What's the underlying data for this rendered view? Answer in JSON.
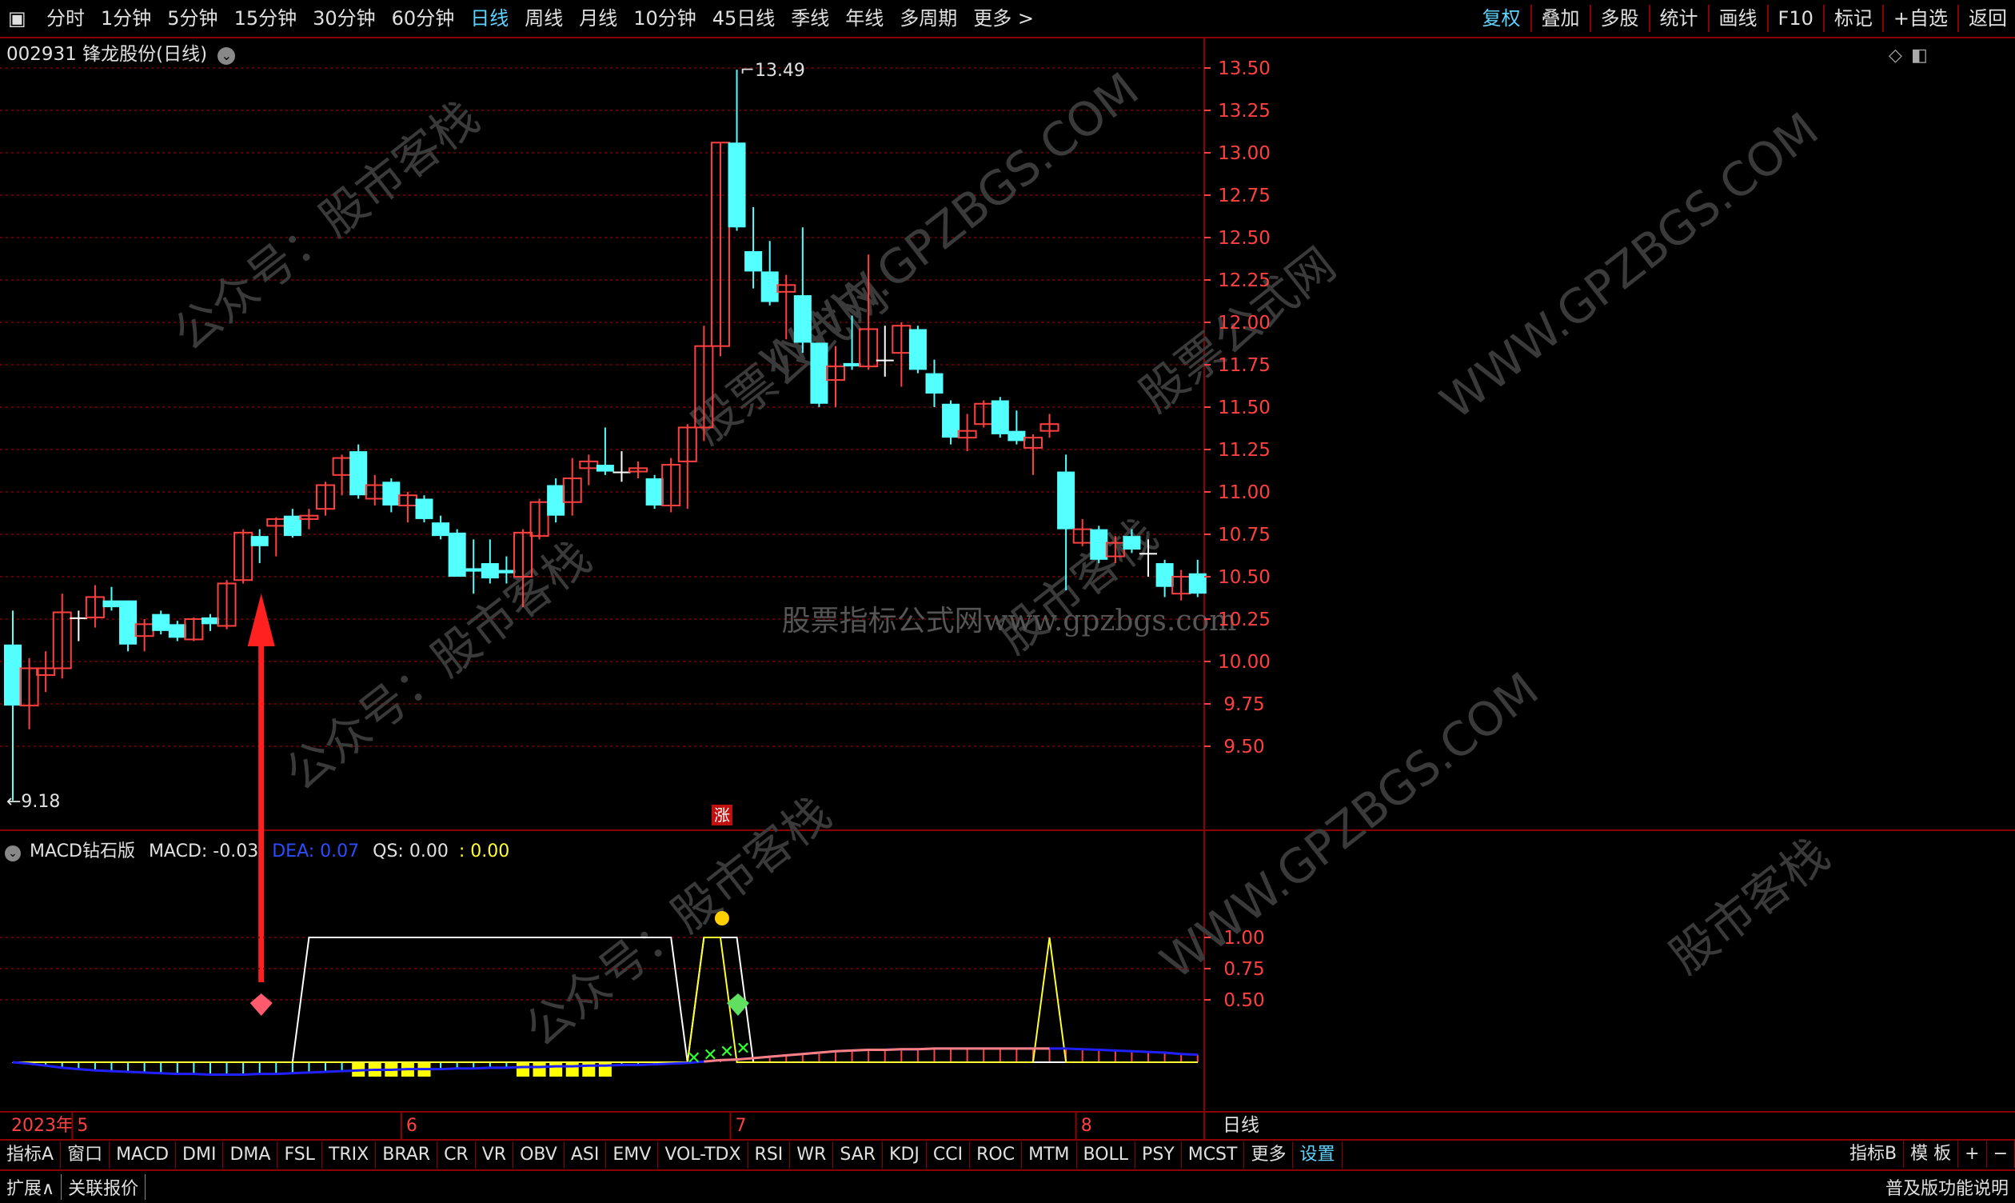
{
  "toolbar": {
    "periods": [
      "分时",
      "1分钟",
      "5分钟",
      "15分钟",
      "30分钟",
      "60分钟",
      "日线",
      "周线",
      "月线",
      "10分钟",
      "45日线",
      "季线",
      "年线",
      "多周期",
      "更多 >"
    ],
    "active_period": "日线",
    "right_tools": [
      "复权",
      "叠加",
      "多股",
      "统计",
      "画线",
      "F10",
      "标记",
      "+自选",
      "返回"
    ],
    "active_tool": "复权"
  },
  "stock": {
    "title": "002931 锋龙股份(日线)"
  },
  "price_axis": [
    "13.50",
    "13.25",
    "13.00",
    "12.75",
    "12.50",
    "12.25",
    "12.00",
    "11.75",
    "11.50",
    "11.25",
    "11.00",
    "10.75",
    "10.50",
    "10.25",
    "10.00",
    "9.75",
    "9.50"
  ],
  "annotations": {
    "high_label": "13.49",
    "low_label": "9.18",
    "zhang_badge": "涨",
    "watermark_center": "股票指标公式网www.gpzbgs.com",
    "watermarks": [
      "公众号：股市客栈",
      "WWW.GPZBGS.COM",
      "股票公式网",
      "股市客栈"
    ]
  },
  "indicator": {
    "name": "MACD钻石版",
    "macd_label": "MACD: -0.03",
    "dea_label": "DEA: 0.07",
    "qs_label": "QS: 0.00",
    "qs_value": ": 0.00",
    "axis": [
      "1.00",
      "0.75",
      "0.50"
    ]
  },
  "dates": {
    "year": "2023年",
    "months": [
      "5",
      "6",
      "7",
      "8"
    ],
    "period": "日线"
  },
  "colors": {
    "up": "#ff4040",
    "down": "#54ffff",
    "grid": "#7a0000",
    "dea": "#2020ff",
    "qs": "#ffff30"
  },
  "chart_data": {
    "type": "candlestick",
    "ylim": [
      9.1,
      13.6
    ],
    "candles": [
      {
        "o": 10.1,
        "c": 9.74,
        "h": 10.3,
        "l": 9.18
      },
      {
        "o": 9.74,
        "c": 9.96,
        "h": 10.02,
        "l": 9.6
      },
      {
        "o": 9.92,
        "c": 9.96,
        "h": 10.06,
        "l": 9.82
      },
      {
        "o": 9.96,
        "c": 10.29,
        "h": 10.4,
        "l": 9.9
      },
      {
        "o": 10.26,
        "c": 10.26,
        "h": 10.3,
        "l": 10.12
      },
      {
        "o": 10.26,
        "c": 10.38,
        "h": 10.45,
        "l": 10.2
      },
      {
        "o": 10.36,
        "c": 10.32,
        "h": 10.44,
        "l": 10.3
      },
      {
        "o": 10.36,
        "c": 10.1,
        "h": 10.36,
        "l": 10.06
      },
      {
        "o": 10.15,
        "c": 10.22,
        "h": 10.25,
        "l": 10.06
      },
      {
        "o": 10.28,
        "c": 10.18,
        "h": 10.3,
        "l": 10.16
      },
      {
        "o": 10.22,
        "c": 10.14,
        "h": 10.24,
        "l": 10.12
      },
      {
        "o": 10.13,
        "c": 10.25,
        "h": 10.26,
        "l": 10.12
      },
      {
        "o": 10.26,
        "c": 10.22,
        "h": 10.28,
        "l": 10.18
      },
      {
        "o": 10.21,
        "c": 10.46,
        "h": 10.48,
        "l": 10.19
      },
      {
        "o": 10.48,
        "c": 10.76,
        "h": 10.78,
        "l": 10.46
      },
      {
        "o": 10.74,
        "c": 10.68,
        "h": 10.78,
        "l": 10.58
      },
      {
        "o": 10.8,
        "c": 10.84,
        "h": 10.85,
        "l": 10.62
      },
      {
        "o": 10.86,
        "c": 10.74,
        "h": 10.9,
        "l": 10.73
      },
      {
        "o": 10.84,
        "c": 10.86,
        "h": 10.9,
        "l": 10.78
      },
      {
        "o": 10.9,
        "c": 11.04,
        "h": 11.06,
        "l": 10.86
      },
      {
        "o": 11.1,
        "c": 11.2,
        "h": 11.22,
        "l": 10.98
      },
      {
        "o": 11.24,
        "c": 10.98,
        "h": 11.28,
        "l": 10.96
      },
      {
        "o": 10.96,
        "c": 11.04,
        "h": 11.1,
        "l": 10.92
      },
      {
        "o": 11.06,
        "c": 10.92,
        "h": 11.08,
        "l": 10.88
      },
      {
        "o": 10.92,
        "c": 10.98,
        "h": 11.0,
        "l": 10.82
      },
      {
        "o": 10.96,
        "c": 10.84,
        "h": 10.98,
        "l": 10.82
      },
      {
        "o": 10.82,
        "c": 10.74,
        "h": 10.86,
        "l": 10.72
      },
      {
        "o": 10.76,
        "c": 10.5,
        "h": 10.78,
        "l": 10.5
      },
      {
        "o": 10.55,
        "c": 10.53,
        "h": 10.72,
        "l": 10.4
      },
      {
        "o": 10.58,
        "c": 10.49,
        "h": 10.72,
        "l": 10.46
      },
      {
        "o": 10.54,
        "c": 10.52,
        "h": 10.62,
        "l": 10.46
      },
      {
        "o": 10.5,
        "c": 10.76,
        "h": 10.78,
        "l": 10.32
      },
      {
        "o": 10.74,
        "c": 10.94,
        "h": 10.96,
        "l": 10.72
      },
      {
        "o": 11.04,
        "c": 10.86,
        "h": 11.08,
        "l": 10.82
      },
      {
        "o": 10.94,
        "c": 11.08,
        "h": 11.2,
        "l": 10.86
      },
      {
        "o": 11.14,
        "c": 11.18,
        "h": 11.22,
        "l": 11.04
      },
      {
        "o": 11.16,
        "c": 11.12,
        "h": 11.38,
        "l": 11.1
      },
      {
        "o": 11.12,
        "c": 11.12,
        "h": 11.24,
        "l": 11.06
      },
      {
        "o": 11.12,
        "c": 11.14,
        "h": 11.18,
        "l": 11.08
      },
      {
        "o": 11.08,
        "c": 10.92,
        "h": 11.1,
        "l": 10.9
      },
      {
        "o": 10.92,
        "c": 11.16,
        "h": 11.2,
        "l": 10.88
      },
      {
        "o": 11.18,
        "c": 11.38,
        "h": 11.4,
        "l": 10.9
      },
      {
        "o": 11.38,
        "c": 11.86,
        "h": 11.98,
        "l": 11.3
      },
      {
        "o": 11.86,
        "c": 13.06,
        "h": 13.06,
        "l": 11.8
      },
      {
        "o": 13.06,
        "c": 12.56,
        "h": 13.49,
        "l": 12.54
      },
      {
        "o": 12.42,
        "c": 12.3,
        "h": 12.68,
        "l": 12.2
      },
      {
        "o": 12.3,
        "c": 12.12,
        "h": 12.48,
        "l": 12.1
      },
      {
        "o": 12.18,
        "c": 12.22,
        "h": 12.28,
        "l": 11.9
      },
      {
        "o": 12.16,
        "c": 11.88,
        "h": 12.56,
        "l": 11.82
      },
      {
        "o": 11.88,
        "c": 11.52,
        "h": 11.88,
        "l": 11.5
      },
      {
        "o": 11.66,
        "c": 11.74,
        "h": 11.86,
        "l": 11.5
      },
      {
        "o": 11.76,
        "c": 11.74,
        "h": 12.04,
        "l": 11.72
      },
      {
        "o": 11.74,
        "c": 11.96,
        "h": 12.4,
        "l": 11.72
      },
      {
        "o": 11.78,
        "c": 11.78,
        "h": 11.98,
        "l": 11.68
      },
      {
        "o": 11.82,
        "c": 11.98,
        "h": 12.0,
        "l": 11.62
      },
      {
        "o": 11.96,
        "c": 11.72,
        "h": 11.98,
        "l": 11.7
      },
      {
        "o": 11.7,
        "c": 11.58,
        "h": 11.78,
        "l": 11.5
      },
      {
        "o": 11.52,
        "c": 11.32,
        "h": 11.54,
        "l": 11.28
      },
      {
        "o": 11.32,
        "c": 11.36,
        "h": 11.46,
        "l": 11.24
      },
      {
        "o": 11.4,
        "c": 11.52,
        "h": 11.54,
        "l": 11.38
      },
      {
        "o": 11.54,
        "c": 11.34,
        "h": 11.56,
        "l": 11.32
      },
      {
        "o": 11.36,
        "c": 11.3,
        "h": 11.48,
        "l": 11.28
      },
      {
        "o": 11.26,
        "c": 11.32,
        "h": 11.34,
        "l": 11.1
      },
      {
        "o": 11.36,
        "c": 11.4,
        "h": 11.46,
        "l": 11.32
      },
      {
        "o": 11.12,
        "c": 10.78,
        "h": 11.22,
        "l": 10.42
      },
      {
        "o": 10.7,
        "c": 10.78,
        "h": 10.84,
        "l": 10.68
      },
      {
        "o": 10.78,
        "c": 10.6,
        "h": 10.8,
        "l": 10.58
      },
      {
        "o": 10.62,
        "c": 10.7,
        "h": 10.74,
        "l": 10.58
      },
      {
        "o": 10.74,
        "c": 10.66,
        "h": 10.78,
        "l": 10.64
      },
      {
        "o": 10.64,
        "c": 10.64,
        "h": 10.72,
        "l": 10.5
      },
      {
        "o": 10.58,
        "c": 10.44,
        "h": 10.6,
        "l": 10.38
      },
      {
        "o": 10.4,
        "c": 10.5,
        "h": 10.54,
        "l": 10.36
      },
      {
        "o": 10.52,
        "c": 10.4,
        "h": 10.6,
        "l": 10.38
      }
    ],
    "indicator_ylim": [
      -0.25,
      1.25
    ],
    "qs_line": [
      0,
      0,
      0,
      0,
      0,
      0,
      0,
      0,
      0,
      0,
      0,
      0,
      0,
      0,
      0,
      0,
      0,
      0,
      1,
      1,
      1,
      1,
      1,
      1,
      1,
      1,
      1,
      1,
      1,
      1,
      1,
      1,
      1,
      1,
      1,
      1,
      1,
      1,
      1,
      1,
      1,
      0,
      1,
      1,
      1,
      0,
      0,
      0,
      0,
      0,
      0,
      0,
      0,
      0,
      0,
      0,
      0,
      0,
      0,
      0,
      0,
      0,
      0,
      0,
      0,
      0,
      0,
      0,
      0,
      0,
      0,
      0,
      0
    ],
    "qs_yellow": [
      0,
      0,
      0,
      0,
      0,
      0,
      0,
      0,
      0,
      0,
      0,
      0,
      0,
      0,
      0,
      0,
      0,
      0,
      0,
      0,
      0,
      0,
      0,
      0,
      0,
      0,
      0,
      0,
      0,
      0,
      0,
      0,
      0,
      0,
      0,
      0,
      0,
      0,
      0,
      0,
      0,
      0,
      1,
      1,
      0,
      0,
      0,
      0,
      0,
      0,
      0,
      0,
      0,
      0,
      0,
      0,
      0,
      0,
      0,
      0,
      0,
      0,
      0,
      1,
      0,
      0,
      0,
      0,
      0,
      0,
      0,
      0,
      0
    ],
    "dea": [
      0,
      -0.02,
      -0.05,
      -0.08,
      -0.1,
      -0.12,
      -0.13,
      -0.14,
      -0.15,
      -0.16,
      -0.17,
      -0.17,
      -0.18,
      -0.18,
      -0.18,
      -0.17,
      -0.17,
      -0.16,
      -0.15,
      -0.14,
      -0.13,
      -0.12,
      -0.11,
      -0.11,
      -0.1,
      -0.1,
      -0.1,
      -0.09,
      -0.09,
      -0.08,
      -0.08,
      -0.07,
      -0.07,
      -0.06,
      -0.06,
      -0.05,
      -0.05,
      -0.04,
      -0.04,
      -0.03,
      -0.02,
      -0.01,
      0.01,
      0.03,
      0.04,
      0.06,
      0.08,
      0.1,
      0.12,
      0.14,
      0.16,
      0.17,
      0.18,
      0.18,
      0.19,
      0.19,
      0.2,
      0.2,
      0.2,
      0.2,
      0.2,
      0.2,
      0.2,
      0.2,
      0.2,
      0.19,
      0.18,
      0.17,
      0.16,
      0.15,
      0.14,
      0.12,
      0.11
    ],
    "macd": [
      -0.01,
      -0.02,
      -0.05,
      -0.08,
      -0.1,
      -0.12,
      -0.13,
      -0.14,
      -0.15,
      -0.16,
      -0.17,
      -0.17,
      -0.18,
      -0.18,
      -0.18,
      -0.17,
      -0.17,
      -0.16,
      -0.15,
      -0.14,
      -0.13,
      -0.12,
      -0.11,
      -0.11,
      -0.1,
      -0.1,
      -0.1,
      -0.09,
      -0.09,
      -0.08,
      -0.08,
      -0.07,
      -0.07,
      -0.06,
      -0.06,
      -0.05,
      -0.05,
      -0.04,
      -0.04,
      -0.03,
      -0.02,
      -0.01,
      0.01,
      0.03,
      0.04,
      0.06,
      0.08,
      0.1,
      0.12,
      0.14,
      0.16,
      0.17,
      0.18,
      0.18,
      0.19,
      0.19,
      0.2,
      0.2,
      0.2,
      0.2,
      0.2,
      0.2,
      0.2,
      0.2,
      0.2,
      0.19,
      0.18,
      0.17,
      0.16,
      0.15,
      0.14,
      0.12,
      0.11
    ]
  }
}
